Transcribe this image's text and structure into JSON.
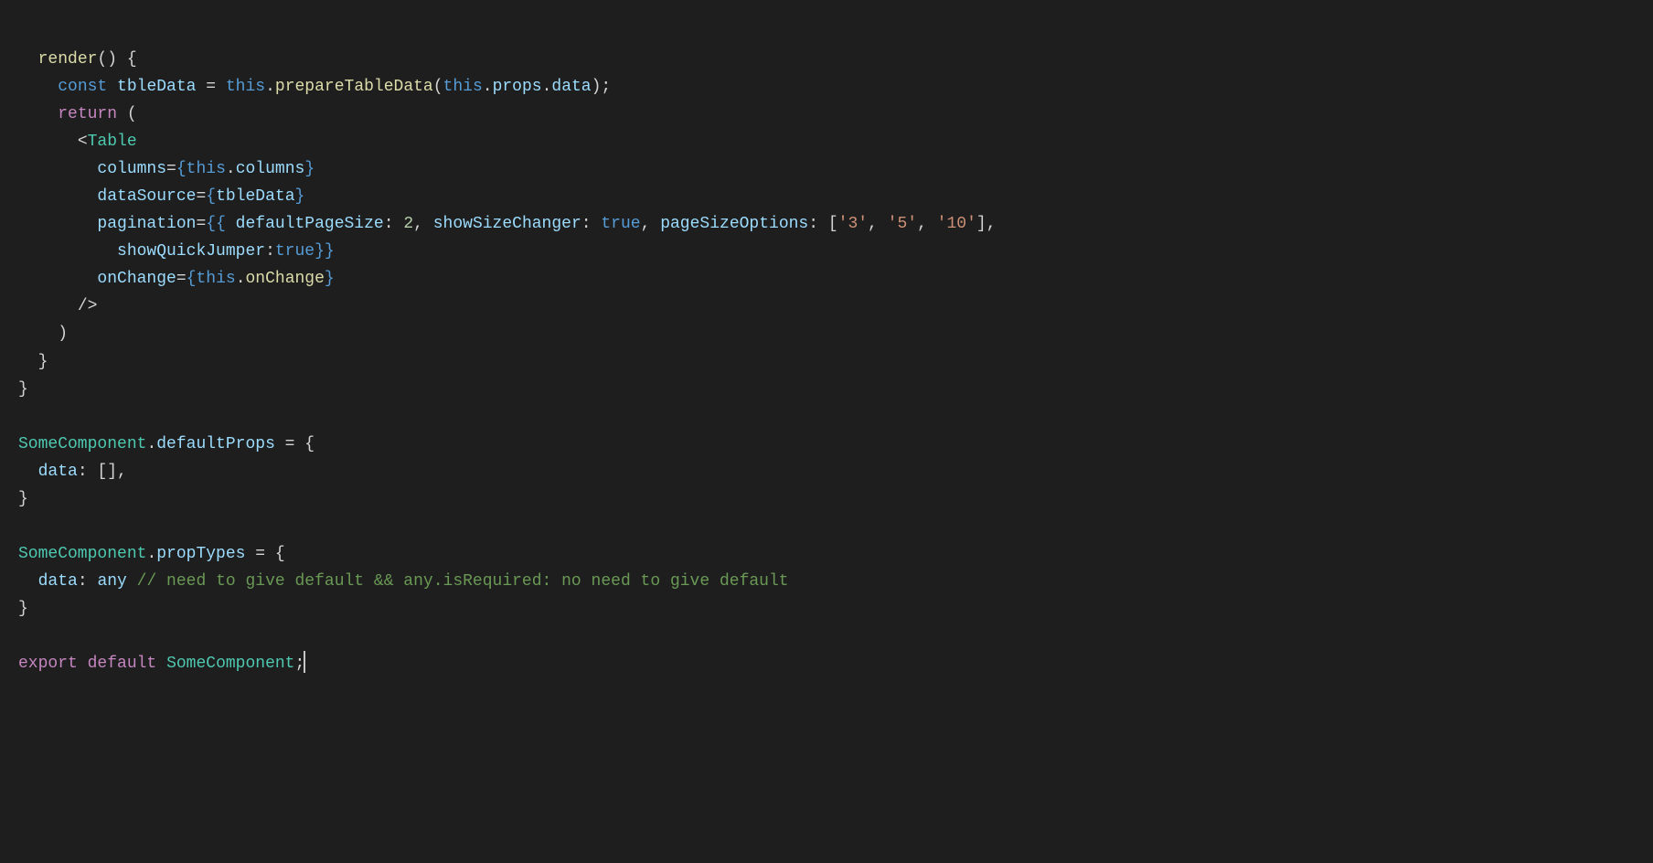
{
  "code": {
    "l1": {
      "a": "  ",
      "fn": "render",
      "b": "() {"
    },
    "l2": {
      "a": "    ",
      "kw": "const",
      "sp": " ",
      "var": "tbleData",
      "eq": " = ",
      "this": "this",
      "dot1": ".",
      "call": "prepareTableData",
      "op": "(",
      "this2": "this",
      "dot2": ".",
      "props": "props",
      "dot3": ".",
      "data": "data",
      "cp": ");"
    },
    "l3": {
      "a": "    ",
      "ret": "return",
      "b": " ("
    },
    "l4": {
      "a": "      ",
      "lt": "<",
      "comp": "Table"
    },
    "l5": {
      "a": "        ",
      "attr": "columns",
      "eq": "=",
      "ob": "{",
      "this": "this",
      "dot": ".",
      "prop": "columns",
      "cb": "}"
    },
    "l6": {
      "a": "        ",
      "attr": "dataSource",
      "eq": "=",
      "ob": "{",
      "var": "tbleData",
      "cb": "}"
    },
    "l7": {
      "a": "        ",
      "attr": "pagination",
      "eq": "=",
      "ob": "{{ ",
      "k1": "defaultPageSize",
      "c1": ": ",
      "v1": "2",
      "s1": ", ",
      "k2": "showSizeChanger",
      "c2": ": ",
      "v2": "true",
      "s2": ", ",
      "k3": "pageSizeOptions",
      "c3": ": [",
      "str1": "'3'",
      "s3": ", ",
      "str2": "'5'",
      "s4": ", ",
      "str3": "'10'",
      "s5": "], "
    },
    "l8": {
      "a": "          ",
      "k": "showQuickJumper",
      "c": ":",
      "v": "true",
      "cb": "}}"
    },
    "l9": {
      "a": "        ",
      "attr": "onChange",
      "eq": "=",
      "ob": "{",
      "this": "this",
      "dot": ".",
      "prop": "onChange",
      "cb": "}"
    },
    "l10": {
      "a": "      ",
      "t": "/>"
    },
    "l11": {
      "a": "    ",
      "t": ")"
    },
    "l12": {
      "a": "  ",
      "t": "}"
    },
    "l13": {
      "t": "}"
    },
    "l14": {
      "t": ""
    },
    "l15": {
      "comp": "SomeComponent",
      "dot": ".",
      "prop": "defaultProps",
      "eq": " = {"
    },
    "l16": {
      "a": "  ",
      "k": "data",
      "c": ": [],"
    },
    "l17": {
      "t": "}"
    },
    "l18": {
      "t": ""
    },
    "l19": {
      "comp": "SomeComponent",
      "dot": ".",
      "prop": "propTypes",
      "eq": " = {"
    },
    "l20": {
      "a": "  ",
      "k": "data",
      "c": ": ",
      "v": "any",
      "sp": " ",
      "cm": "// need to give default && any.isRequired: no need to give default"
    },
    "l21": {
      "t": "}"
    },
    "l22": {
      "t": ""
    },
    "l23": {
      "exp": "export",
      "sp": " ",
      "def": "default",
      "sp2": " ",
      "comp": "SomeComponent",
      "sc": ";"
    }
  }
}
